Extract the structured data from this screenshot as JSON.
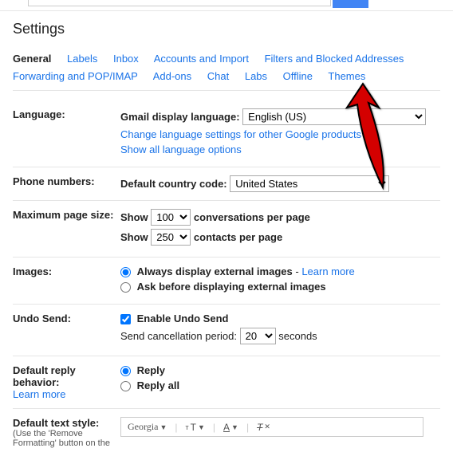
{
  "title": "Settings",
  "tabs": [
    "General",
    "Labels",
    "Inbox",
    "Accounts and Import",
    "Filters and Blocked Addresses",
    "Forwarding and POP/IMAP",
    "Add-ons",
    "Chat",
    "Labs",
    "Offline",
    "Themes"
  ],
  "language": {
    "label": "Language:",
    "display_label": "Gmail display language:",
    "value": "English (US)",
    "change_link": "Change language settings for other Google products",
    "show_all": "Show all language options"
  },
  "phone": {
    "label": "Phone numbers:",
    "code_label": "Default country code:",
    "value": "United States"
  },
  "page_size": {
    "label": "Maximum page size:",
    "show": "Show",
    "conv_value": "100",
    "conv_suffix": "conversations per page",
    "contacts_value": "250",
    "contacts_suffix": "contacts per page"
  },
  "images": {
    "label": "Images:",
    "opt1": "Always display external images",
    "learn": "Learn more",
    "opt2": "Ask before displaying external images"
  },
  "undo": {
    "label": "Undo Send:",
    "enable": "Enable Undo Send",
    "period_label": "Send cancellation period:",
    "value": "20",
    "suffix": "seconds"
  },
  "reply": {
    "label": "Default reply behavior:",
    "learn": "Learn more",
    "opt1": "Reply",
    "opt2": "Reply all"
  },
  "text_style": {
    "label": "Default text style:",
    "sub": "(Use the 'Remove Formatting' button on the",
    "font": "Georgia"
  }
}
